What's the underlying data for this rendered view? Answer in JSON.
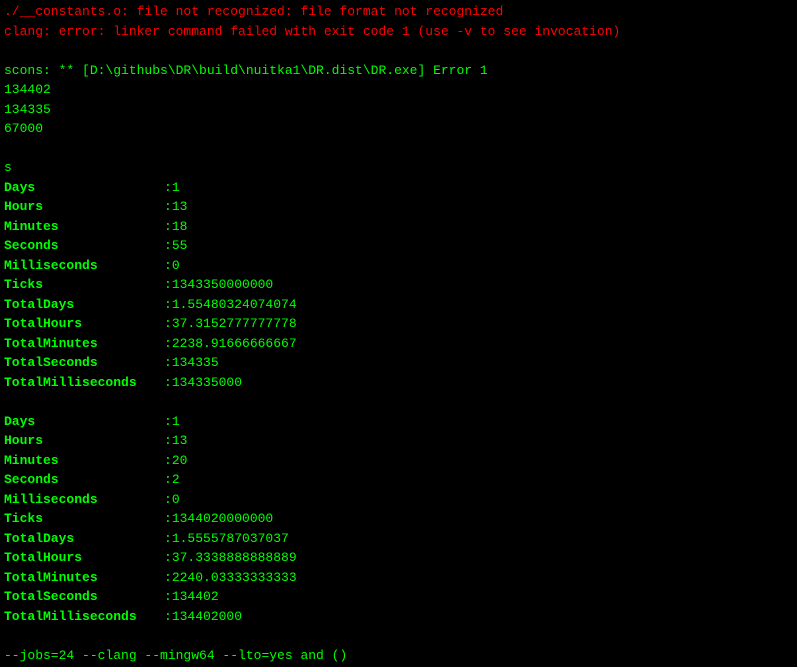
{
  "terminal": {
    "lines": [
      {
        "type": "error",
        "text": "./__constants.o: file not recognized: file format not recognized"
      },
      {
        "type": "error",
        "text": "clang: error: linker command failed with exit code 1 (use -v to see invocation)"
      },
      {
        "type": "blank",
        "text": ""
      },
      {
        "type": "normal",
        "text": "scons: ** [D:\\githubs\\DR\\build\\nuitka1\\DR.dist\\DR.exe] Error 1"
      },
      {
        "type": "normal",
        "text": "134402"
      },
      {
        "type": "normal",
        "text": "134335"
      },
      {
        "type": "normal",
        "text": "67000"
      },
      {
        "type": "blank",
        "text": ""
      },
      {
        "type": "normal",
        "text": "s"
      }
    ],
    "block1": {
      "rows": [
        {
          "label": "Days",
          "value": "1"
        },
        {
          "label": "Hours",
          "value": "13"
        },
        {
          "label": "Minutes",
          "value": "18"
        },
        {
          "label": "Seconds",
          "value": "55"
        },
        {
          "label": "Milliseconds",
          "value": "0"
        },
        {
          "label": "Ticks",
          "value": "1343350000000"
        },
        {
          "label": "TotalDays",
          "value": "1.55480324074074"
        },
        {
          "label": "TotalHours",
          "value": "37.3152777777778"
        },
        {
          "label": "TotalMinutes",
          "value": "2238.91666666667"
        },
        {
          "label": "TotalSeconds",
          "value": "134335"
        },
        {
          "label": "TotalMilliseconds",
          "value": "134335000"
        }
      ]
    },
    "block2": {
      "rows": [
        {
          "label": "Days",
          "value": "1"
        },
        {
          "label": "Hours",
          "value": "13"
        },
        {
          "label": "Minutes",
          "value": "20"
        },
        {
          "label": "Seconds",
          "value": "2"
        },
        {
          "label": "Milliseconds",
          "value": "0"
        },
        {
          "label": "Ticks",
          "value": "1344020000000"
        },
        {
          "label": "TotalDays",
          "value": "1.5555787037037"
        },
        {
          "label": "TotalHours",
          "value": "37.3338888888889"
        },
        {
          "label": "TotalMinutes",
          "value": "2240.03333333333"
        },
        {
          "label": "TotalSeconds",
          "value": "134402"
        },
        {
          "label": "TotalMilliseconds",
          "value": "134402000"
        }
      ]
    },
    "footer": "--jobs=24 --clang --mingw64 --lto=yes and ()"
  }
}
